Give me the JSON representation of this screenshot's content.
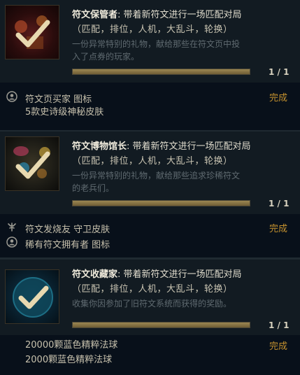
{
  "missions": [
    {
      "name": "符文保管者",
      "title_rest": ": 带着新符文进行一场匹配对局",
      "modes": "（匹配，排位，人机，大乱斗，轮换）",
      "desc_line1": "一份异常特别的礼物，献给那些在符文页中投",
      "desc_line2": "入了点券的玩家。",
      "progress_value": 1.0,
      "progress_text": "1 / 1",
      "rewards": [
        {
          "icon": "person-circle-icon",
          "text": "符文页买家 图标"
        },
        {
          "icon": "",
          "text": "5款史诗级神秘皮肤"
        }
      ],
      "status": "完成"
    },
    {
      "name": "符文博物馆长",
      "title_rest": ": 带着新符文进行一场匹配对局",
      "modes": "（匹配，排位，人机，大乱斗，轮换）",
      "desc_line1": "一份异常特别的礼物，献给那些追求珍稀符文",
      "desc_line2": "的老兵们。",
      "progress_value": 1.0,
      "progress_text": "1 / 1",
      "rewards": [
        {
          "icon": "ward-skin-icon",
          "text": "符文发烧友 守卫皮肤"
        },
        {
          "icon": "person-circle-icon",
          "text": "稀有符文拥有者 图标"
        }
      ],
      "status": "完成"
    },
    {
      "name": "符文收藏家",
      "title_rest": ": 带着新符文进行一场匹配对局",
      "modes": "（匹配，排位，人机，大乱斗，轮换）",
      "desc_line1": "收集你因参加了旧符文系统而获得的奖励。",
      "desc_line2": "",
      "progress_value": 1.0,
      "progress_text": "1 / 1",
      "rewards": [
        {
          "icon": "",
          "text": "20000颗蓝色精粹法球"
        },
        {
          "icon": "",
          "text": "2000颗蓝色精粹法球"
        }
      ],
      "status": "完成"
    }
  ],
  "colors": {
    "accent_gold": "#c4912e",
    "progress_fill": "#9c8752",
    "panel_bg": "#121b22"
  }
}
